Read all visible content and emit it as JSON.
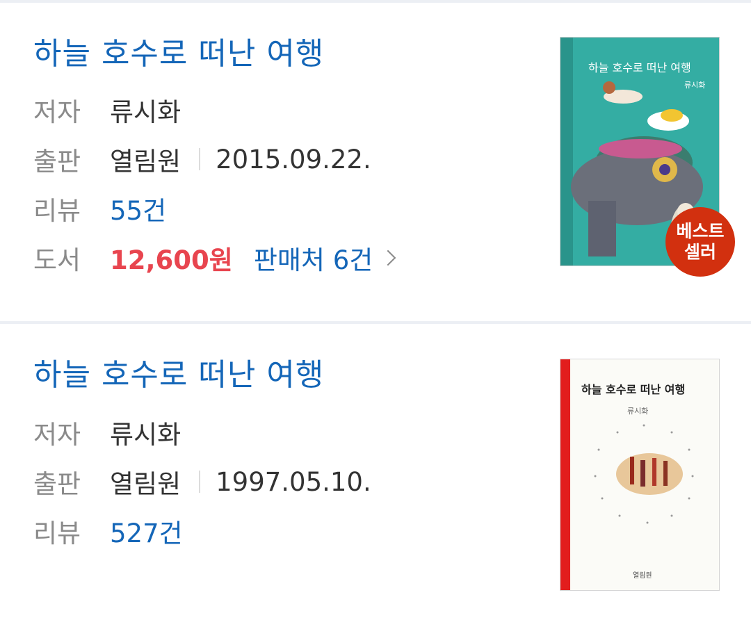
{
  "items": [
    {
      "title": "하늘 호수로 떠난 여행",
      "author_label": "저자",
      "author": "류시화",
      "publisher_label": "출판",
      "publisher": "열림원",
      "date": "2015.09.22.",
      "review_label": "리뷰",
      "reviews": "55건",
      "book_label": "도서",
      "price": "12,600원",
      "sellers": "판매처 6건",
      "badge_line1": "베스트",
      "badge_line2": "셀러",
      "cover_title": "하늘 호수로 떠난 여행",
      "cover_author": "류시화"
    },
    {
      "title": "하늘 호수로 떠난 여행",
      "author_label": "저자",
      "author": "류시화",
      "publisher_label": "출판",
      "publisher": "열림원",
      "date": "1997.05.10.",
      "review_label": "리뷰",
      "reviews": "527건",
      "cover_title": "하늘 호수로 떠난 여행",
      "cover_author": "류시화",
      "cover_publisher": "열림원"
    }
  ],
  "colors": {
    "link": "#1466b8",
    "price": "#e8454f",
    "badge": "#d2300f"
  },
  "icons": [
    "chevron-right-icon"
  ]
}
